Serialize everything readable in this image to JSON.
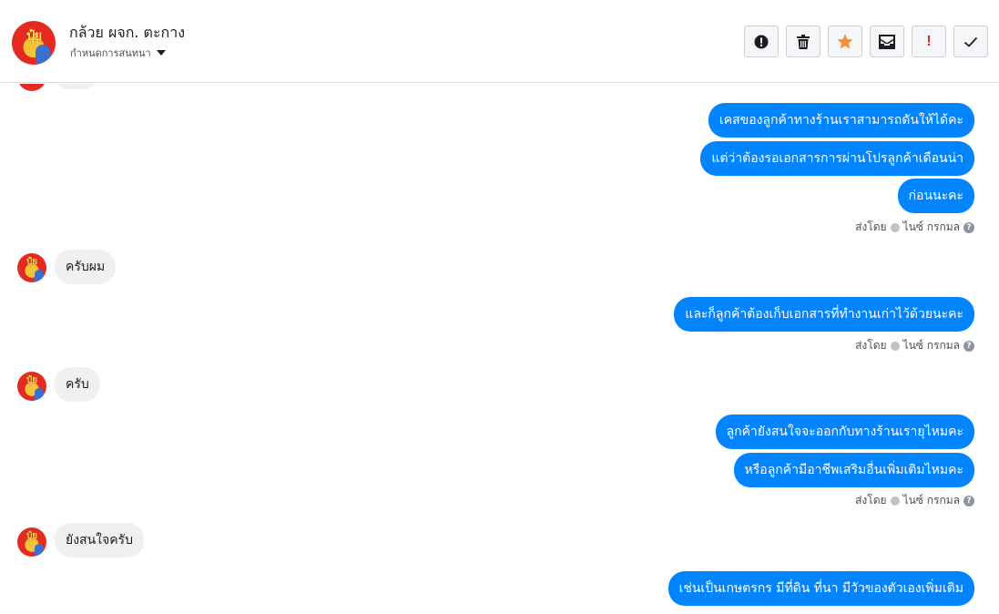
{
  "header": {
    "title": "กล้วย ผจก. ตะกาง",
    "subtitle": "กำหนดการสนทนา",
    "avatar_text": "ปุ๋ย",
    "toolbar": {
      "report_icon": "alert-circle-icon",
      "delete_icon": "trash-icon",
      "star_icon": "star-icon",
      "inbox_icon": "mail-box-icon",
      "important_label": "!",
      "done_icon": "check-icon"
    }
  },
  "colors": {
    "outgoing_bubble": "#0084ff",
    "incoming_bubble": "#f1f0f0",
    "star": "#f7923b",
    "alert": "#e02424"
  },
  "messages": [
    {
      "dir": "out",
      "text": "เคสของลูกค้าทางร้านเราสามารถดันให้ได้คะ"
    },
    {
      "dir": "out",
      "text": "แต่ว่าต้องรอเอกสารการผ่านโปรลูกค้าเดือนน่า"
    },
    {
      "dir": "out",
      "text": "ก่อนนะคะ"
    },
    {
      "dir": "status",
      "sent_by": "ส่งโดย",
      "sender": "ไนซ์ กรกมล",
      "help": "?"
    },
    {
      "dir": "in",
      "text": "ครับผม",
      "avatar_text": "ปุ๋ย"
    },
    {
      "dir": "out",
      "text": "และก็ลูกค้าต้องเก็บเอกสารที่ทำงานเก่าไว้ด้วยนะคะ"
    },
    {
      "dir": "status",
      "sent_by": "ส่งโดย",
      "sender": "ไนซ์ กรกมล",
      "help": "?"
    },
    {
      "dir": "in",
      "text": "ครับ",
      "avatar_text": "ปุ๋ย"
    },
    {
      "dir": "out",
      "text": "ลูกค้ายังสนใจจะออกกับทางร้านเรายุไหมคะ"
    },
    {
      "dir": "out",
      "text": "หรือลูกค้ามีอาชีพเสริมอื่นเพิ่มเติมไหมคะ"
    },
    {
      "dir": "status",
      "sent_by": "ส่งโดย",
      "sender": "ไนซ์ กรกมล",
      "help": "?"
    },
    {
      "dir": "in",
      "text": "ยังสนใจครับ",
      "avatar_text": "ปุ๋ย"
    },
    {
      "dir": "out",
      "text": "เช่นเป็นเกษตรกร มีที่ดิน ที่นา มีวัวของตัวเองเพิ่มเติม"
    }
  ]
}
